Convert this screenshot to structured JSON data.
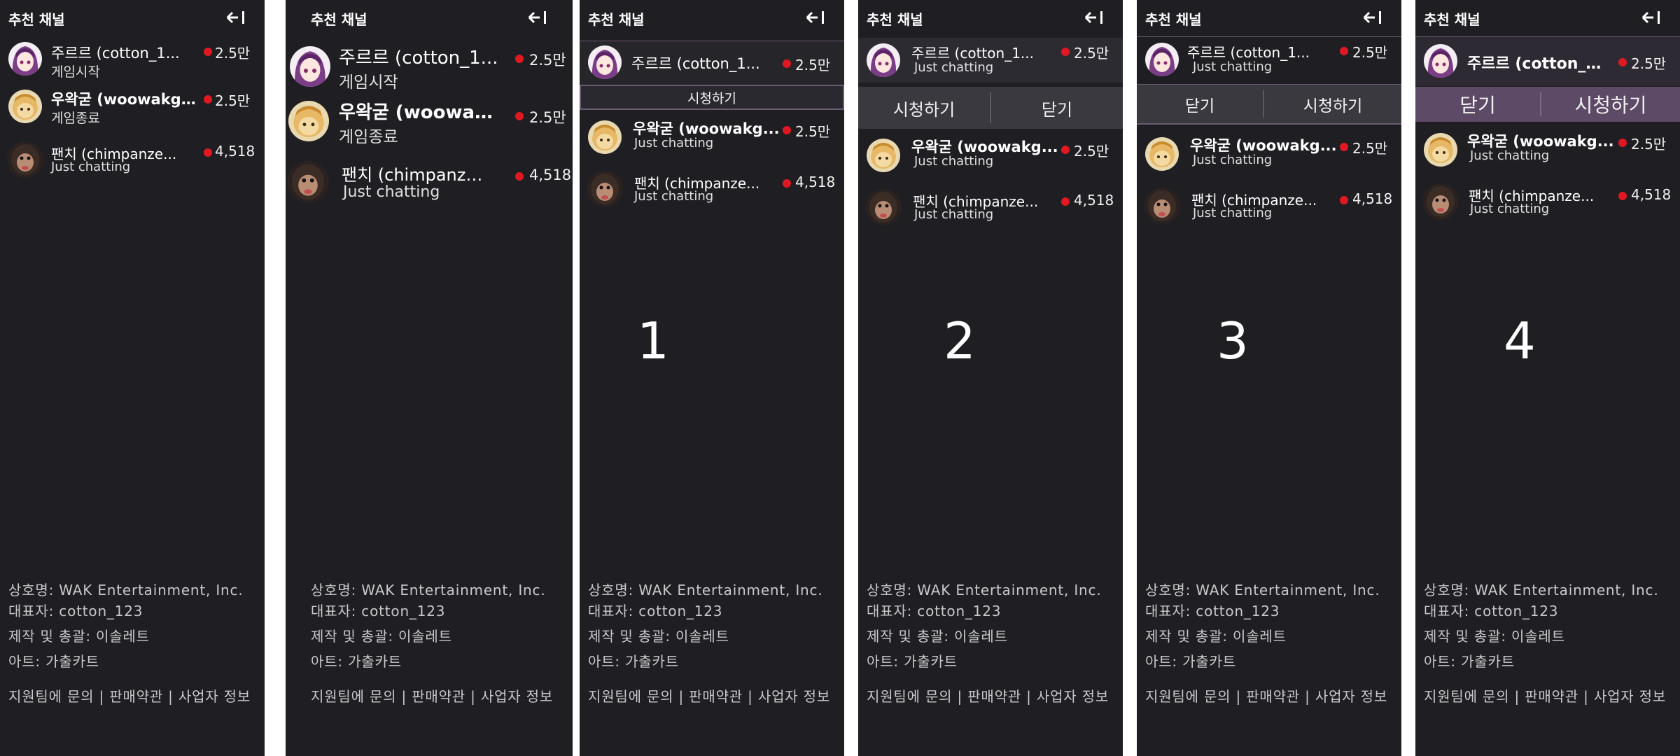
{
  "header_title": "추천 채널",
  "channels": [
    {
      "name": "주르르 (cotton_1...",
      "name_short": "주르르 (cotton_1...",
      "status": "게임시작",
      "viewers": "2.5만",
      "avatar": "purple-hair-girl"
    },
    {
      "name": "우왁굳 (woowakg...",
      "status": "게임종료",
      "viewers": "2.5만",
      "avatar": "blonde-character"
    },
    {
      "name": "팬치 (chimpanze...",
      "status": "Just chatting",
      "viewers": "4,518",
      "avatar": "chimpanzee"
    }
  ],
  "just_chatting": "Just chatting",
  "buttons": {
    "watch": "시청하기",
    "close": "닫기"
  },
  "variant_labels": [
    "1",
    "2",
    "3",
    "4"
  ],
  "footer": {
    "company": "상호명: WAK Entertainment, Inc.",
    "ceo": "대표자: cotton_123",
    "production": "제작 및 총괄: 이솔레트",
    "art": "아트: 가출카트",
    "links": "지원팀에 문의 | 판매약관 | 사업자 정보"
  },
  "colors": {
    "panel_bg": "#1f1e22",
    "live_dot": "#e01822",
    "highlight": "#5d4a66"
  }
}
